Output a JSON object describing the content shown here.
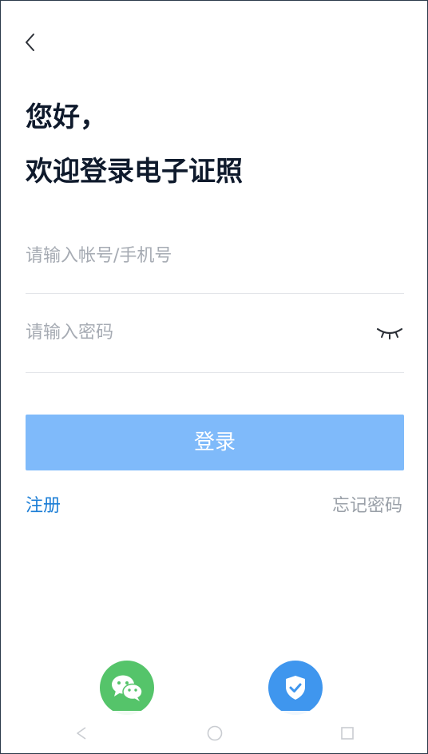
{
  "header": {
    "back_icon": "chevron-left-icon"
  },
  "greeting": {
    "line1": "您好，",
    "line2": "欢迎登录电子证照"
  },
  "form": {
    "account_placeholder": "请输入帐号/手机号",
    "account_value": "",
    "password_placeholder": "请输入密码",
    "password_value": "",
    "password_toggle_icon": "eye-closed-icon"
  },
  "actions": {
    "login_label": "登录",
    "register_label": "注册",
    "forgot_label": "忘记密码"
  },
  "third_party": {
    "wechat_icon": "wechat-icon",
    "shield_icon": "shield-check-icon"
  },
  "system_nav": {
    "back_icon": "nav-back-icon",
    "home_icon": "nav-home-icon",
    "recent_icon": "nav-recent-icon"
  },
  "colors": {
    "primary_disabled": "#7fbafa",
    "link": "#1c7ed6",
    "title": "#0f1a2c",
    "wechat": "#55c46a",
    "shield": "#3f96ee"
  }
}
